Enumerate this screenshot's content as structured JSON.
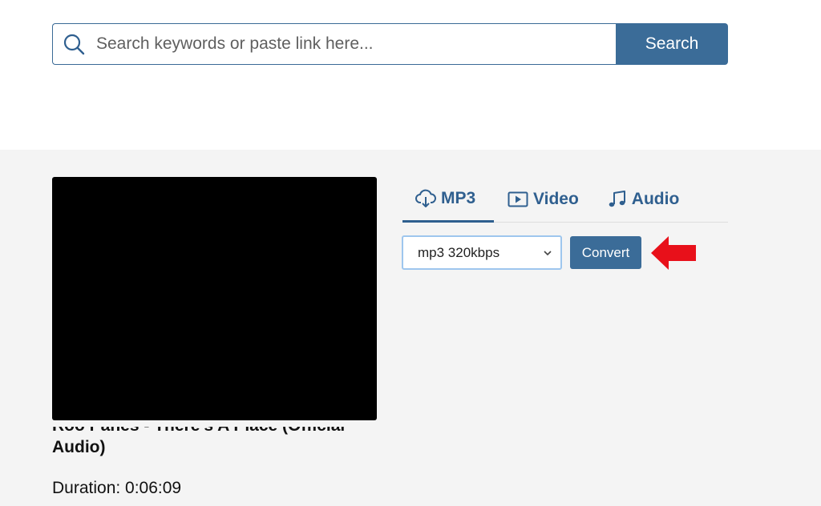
{
  "search": {
    "placeholder": "Search keywords or paste link here...",
    "button_label": "Search"
  },
  "video": {
    "title_line1": "Roo Panes - There's A Place (Official",
    "title_line2": "Audio)",
    "duration": "Duration: 0:06:09"
  },
  "tabs": [
    {
      "label": "MP3",
      "icon": "cloud-download-icon",
      "active": true
    },
    {
      "label": "Video",
      "icon": "play-box-icon",
      "active": false
    },
    {
      "label": "Audio",
      "icon": "music-note-icon",
      "active": false
    }
  ],
  "converter": {
    "selected_format": "mp3 320kbps",
    "convert_label": "Convert"
  },
  "colors": {
    "accent": "#3b6c98",
    "tab_text": "#2f5f8f",
    "panel_bg": "#f4f4f4",
    "arrow": "#e8101a"
  }
}
